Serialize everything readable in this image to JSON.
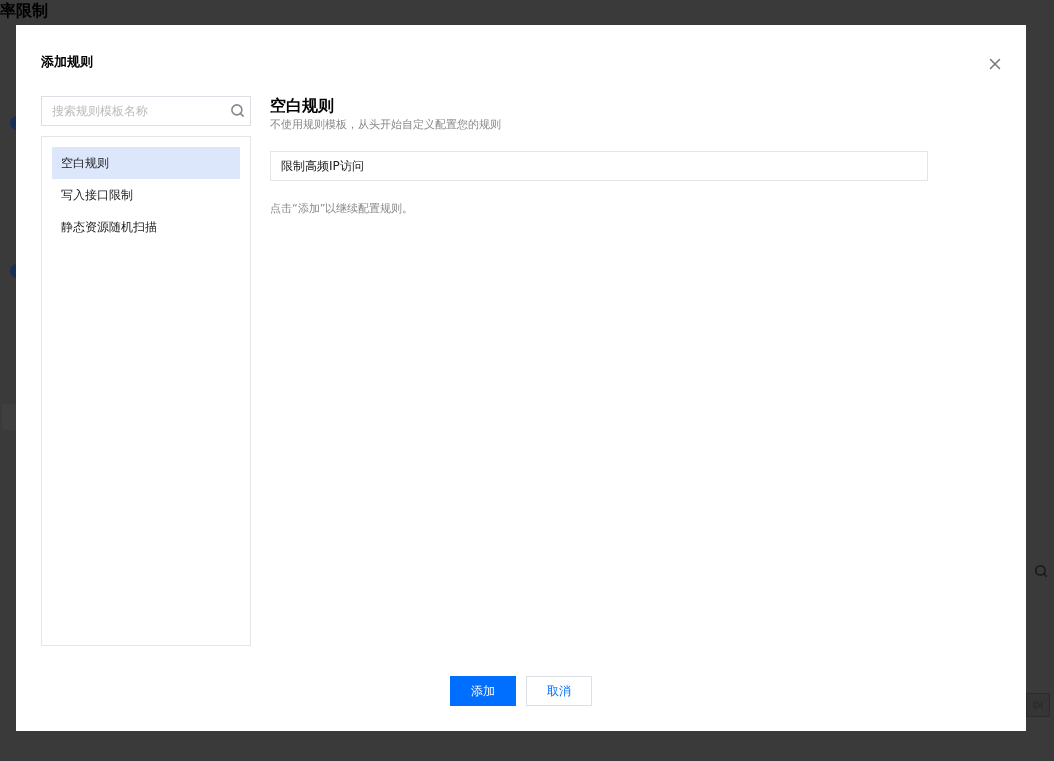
{
  "background_page": {
    "title": "率限制",
    "sections": [
      {
        "kind": "toggle"
      },
      {
        "kind": "toggle"
      },
      {
        "kind": "select"
      },
      {
        "kind": "table"
      }
    ]
  },
  "dialog": {
    "title": "添加规则",
    "search": {
      "placeholder": "搜索规则模板名称"
    },
    "templates": [
      {
        "label": "空白规则",
        "selected": true
      },
      {
        "label": "写入接口限制",
        "selected": false
      },
      {
        "label": "静态资源随机扫描",
        "selected": false
      }
    ],
    "detail": {
      "title": "空白规则",
      "subtitle": "不使用规则模板，从头开始自定义配置您的规则",
      "name_value": "限制高频IP访问",
      "hint": "点击“添加”以继续配置规则。"
    },
    "buttons": [
      {
        "label": "添加",
        "kind": "primary"
      },
      {
        "label": "取消",
        "kind": "secondary"
      }
    ]
  }
}
